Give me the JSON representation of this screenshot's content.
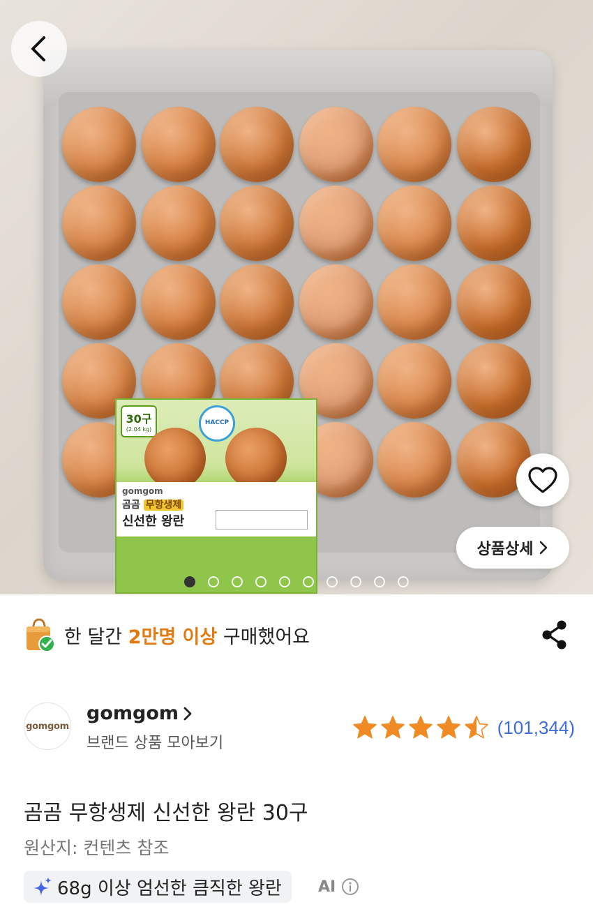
{
  "hero": {
    "back_label": "back",
    "detail_button_label": "상품상세",
    "pager": {
      "total": 10,
      "active_index": 0
    },
    "package_label": {
      "count_big": "30구",
      "count_small": "(2.04 kg)",
      "haccp": "HACCP",
      "brand": "gomgom",
      "name_line1_prefix": "곰곰",
      "name_line1_tag": "무항생제",
      "name_line2": "신선한 왕란"
    }
  },
  "purchase_banner": {
    "prefix": "한 달간 ",
    "highlight": "2만명 이상",
    "suffix": " 구매했어요"
  },
  "brand": {
    "logo_text": "gomgom",
    "name": "gomgom",
    "subtitle": "브랜드 상품 모아보기"
  },
  "rating": {
    "stars": 4.5,
    "review_count": "(101,344)"
  },
  "product": {
    "title": "곰곰 무항생제 신선한 왕란 30구",
    "origin": "원산지: 컨텐츠 참조"
  },
  "ai_summary": {
    "chip_text": "68g 이상 엄선한 큼직한 왕란",
    "label": "AI"
  },
  "colors": {
    "accent_orange": "#e07b14",
    "star_orange": "#f08a24",
    "link_blue": "#3d6ed8",
    "ai_chip_bg": "#f1f2f4"
  },
  "icons": [
    "back-chevron-icon",
    "heart-icon",
    "chevron-right-icon",
    "shopping-bag-check-icon",
    "share-icon",
    "star-icon",
    "sparkle-icon",
    "info-icon"
  ]
}
